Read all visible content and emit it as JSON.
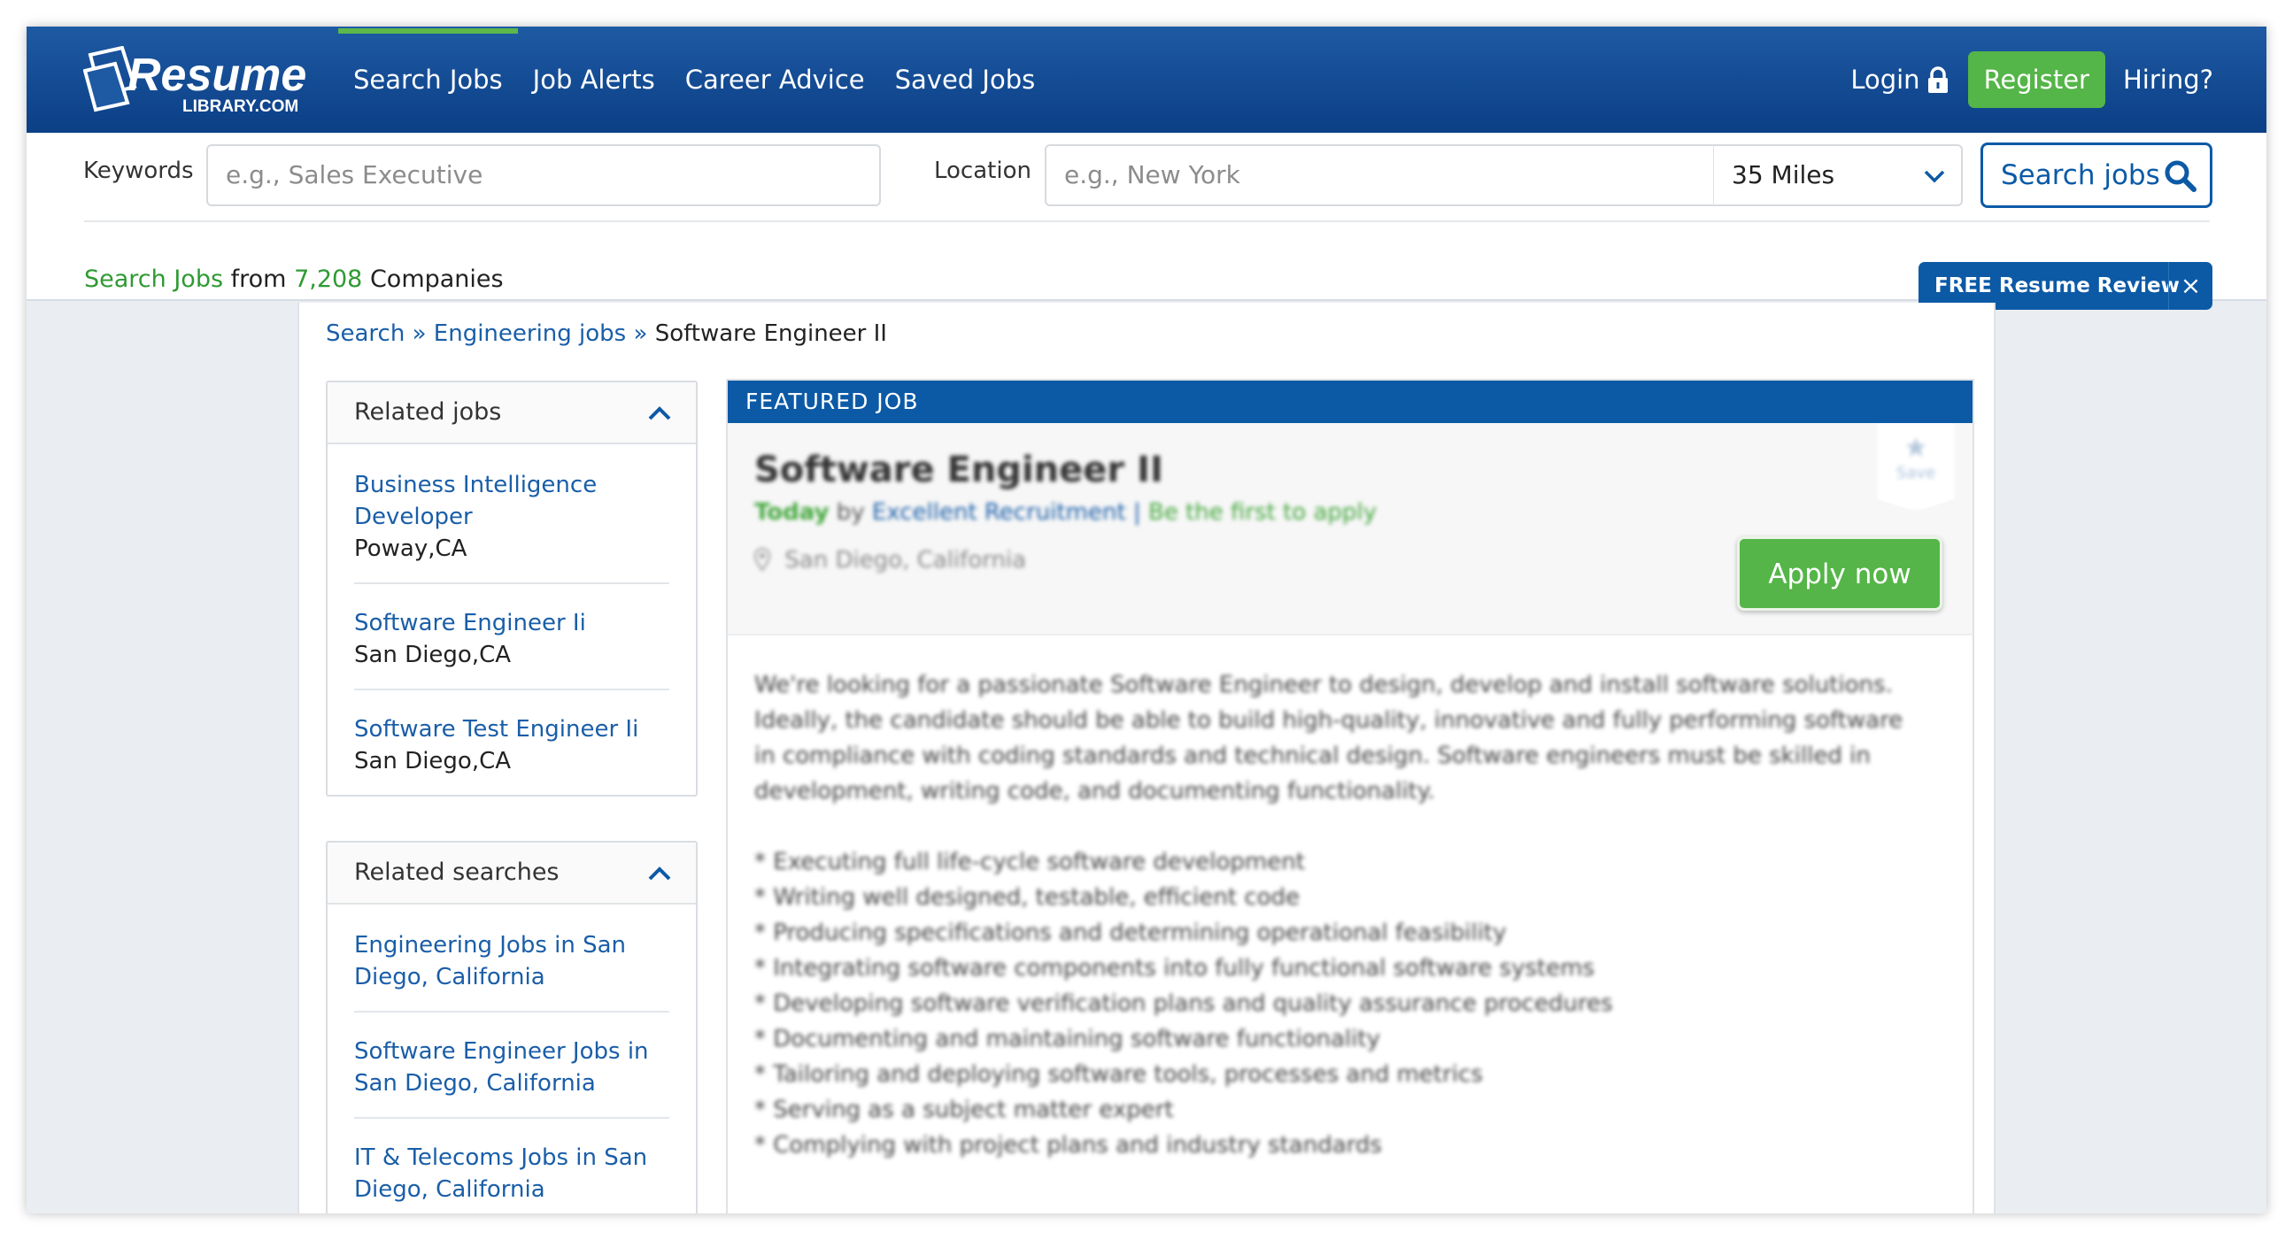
{
  "header": {
    "logo_text": "Resume",
    "logo_subtext": "LIBRARY.COM",
    "nav": [
      {
        "label": "Search Jobs",
        "active": true
      },
      {
        "label": "Job Alerts",
        "active": false
      },
      {
        "label": "Career Advice",
        "active": false
      },
      {
        "label": "Saved Jobs",
        "active": false
      }
    ],
    "login_label": "Login",
    "register_label": "Register",
    "hiring_label": "Hiring?"
  },
  "search": {
    "keywords_label": "Keywords",
    "keywords_placeholder": "e.g., Sales Executive",
    "location_label": "Location",
    "location_placeholder": "e.g., New York",
    "radius_value": "35 Miles",
    "button_label": "Search jobs"
  },
  "companies_bar": {
    "link_text": "Search Jobs",
    "from_text": "from",
    "count": "7,208",
    "suffix": "Companies",
    "promo_label": "FREE Resume Review",
    "promo_close": "×"
  },
  "breadcrumb": {
    "items": [
      "Search",
      "Engineering jobs"
    ],
    "separator": "»",
    "current": "Software Engineer II"
  },
  "related_jobs": {
    "title": "Related jobs",
    "items": [
      {
        "title": "Business Intelligence Developer",
        "location": "Poway,CA"
      },
      {
        "title": "Software Engineer Ii",
        "location": "San Diego,CA"
      },
      {
        "title": "Software Test Engineer Ii",
        "location": "San Diego,CA"
      }
    ]
  },
  "related_searches": {
    "title": "Related searches",
    "items": [
      "Engineering Jobs in San Diego, California",
      "Software Engineer Jobs in San Diego, California",
      "IT & Telecoms Jobs in San Diego, California"
    ]
  },
  "job": {
    "banner": "FEATURED JOB",
    "title": "Software Engineer II",
    "posted": "Today",
    "by": "by",
    "company": "Excellent Recruitment",
    "divider": "|",
    "first_to_apply": "Be the first to apply",
    "location": "San Diego, California",
    "save_label": "Save",
    "apply_label": "Apply now",
    "description": "We're looking for a passionate Software Engineer to design, develop and install software solutions. Ideally, the candidate should be able to build high-quality, innovative and fully performing software in compliance with coding standards and technical design. Software engineers must be skilled in development, writing code, and documenting functionality.",
    "bullets": [
      "* Executing full life-cycle software development",
      "* Writing well designed, testable, efficient code",
      "* Producing specifications and determining operational feasibility",
      "* Integrating software components into fully functional software systems",
      "* Developing software verification plans and quality assurance procedures",
      "* Documenting and maintaining software functionality",
      "* Tailoring and deploying software tools, processes and metrics",
      "* Serving as a subject matter expert",
      "* Complying with project plans and industry standards"
    ]
  },
  "colors": {
    "header_blue": "#0c4a91",
    "accent_green": "#55b548",
    "link_blue": "#1a5ea8",
    "button_blue": "#0c5aa6"
  }
}
